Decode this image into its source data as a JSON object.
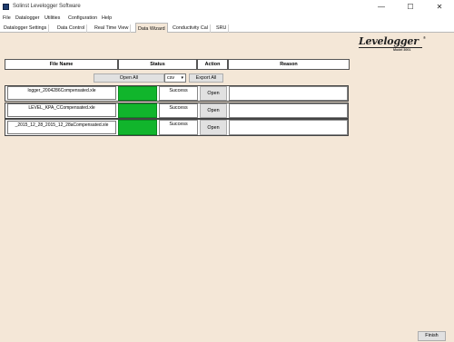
{
  "window": {
    "title": "Solinst Levelogger Software",
    "minimize": "—",
    "maximize": "☐",
    "close": "✕"
  },
  "menu": [
    "File",
    "Datalogger",
    "Utilities",
    "Configuration",
    "Help"
  ],
  "tabs": [
    "Datalogger Settings",
    "Data Control",
    "Real Time View",
    "Data Wizard",
    "Conductivity Cal",
    "SRU"
  ],
  "active_tab": "Data Wizard",
  "logo": {
    "text": "Levelogger",
    "mark": "®",
    "subtitle": "Model 3001"
  },
  "table": {
    "headers": {
      "file_name": "File Name",
      "status": "Status",
      "action": "Action",
      "reason": "Reason"
    },
    "rows": [
      {
        "file": "logger_2004286Compensated.xle",
        "status_color": "#11b52c",
        "message": "Success",
        "action": "Open",
        "reason": ""
      },
      {
        "file": "LEVEL_KPA_CCompensated.xle",
        "status_color": "#11b52c",
        "message": "Success",
        "action": "Open",
        "reason": ""
      },
      {
        "file": "_2015_12_28_2015_12_28aCompensated.xle",
        "status_color": "#11b52c",
        "message": "Success",
        "action": "Open",
        "reason": ""
      }
    ]
  },
  "controls": {
    "open_all": "Open All",
    "format": "csv",
    "export_all": "Export All"
  },
  "finish": "Finish"
}
